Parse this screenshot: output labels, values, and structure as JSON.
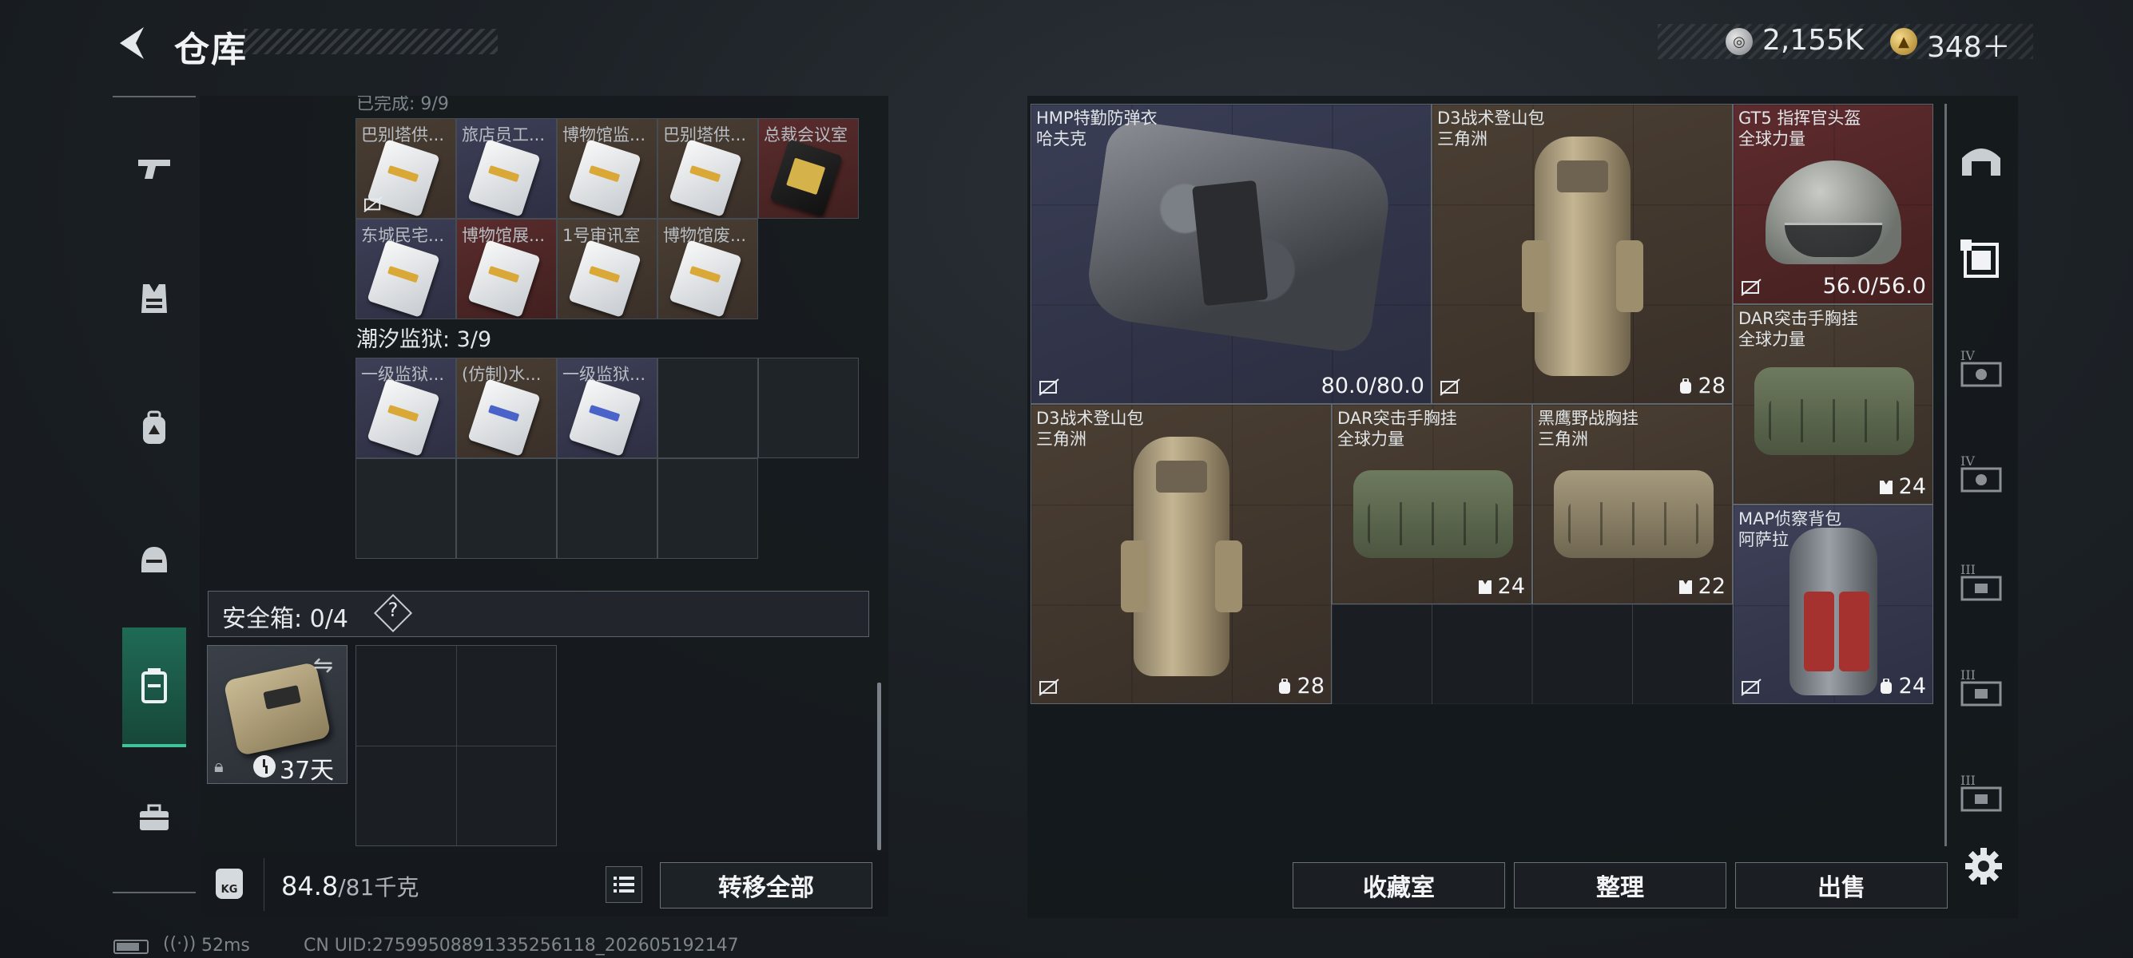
{
  "header": {
    "title": "仓库",
    "currency_1_value": "2,155K",
    "currency_2_value": "348＋"
  },
  "left_nav": {
    "items": [
      "gun-icon",
      "vest-icon",
      "backpack-icon",
      "helmet-icon",
      "container-icon",
      "toolbox-icon"
    ],
    "active": "container-icon"
  },
  "container": {
    "cut_header": "已完成: 9/9",
    "row1": [
      {
        "label": "巴别塔供...",
        "bg": "brown",
        "card": "white"
      },
      {
        "label": "旅店员工...",
        "bg": "purple",
        "card": "white"
      },
      {
        "label": "博物馆监...",
        "bg": "brown",
        "card": "white"
      },
      {
        "label": "巴别塔供...",
        "bg": "brown",
        "card": "white"
      },
      {
        "label": "总裁会议室",
        "bg": "red",
        "card": "gold"
      }
    ],
    "row2": [
      {
        "label": "东城民宅...",
        "bg": "purple",
        "card": "white"
      },
      {
        "label": "博物馆展...",
        "bg": "red",
        "card": "white"
      },
      {
        "label": "1号审讯室",
        "bg": "brown",
        "card": "white"
      },
      {
        "label": "博物馆废...",
        "bg": "brown",
        "card": "white"
      }
    ],
    "section_label": "潮汐监狱: 3/9",
    "section_items": [
      {
        "label": "一级监狱...",
        "bg": "purple",
        "card": "white"
      },
      {
        "label": "(仿制)水...",
        "bg": "brown",
        "card": "blue"
      },
      {
        "label": "一级监狱...",
        "bg": "purple",
        "card": "blue"
      }
    ]
  },
  "safe_box": {
    "label": "安全箱: 0/4",
    "help": "?",
    "item_days": "37天"
  },
  "weight": {
    "kg_label": "KG",
    "current": "84.8",
    "max": "/81千克"
  },
  "buttons": {
    "transfer_all": "转移全部",
    "collection_room": "收藏室",
    "organize": "整理",
    "sell": "出售"
  },
  "status_bar": {
    "ping": "52ms",
    "uid": "CN UID:2759950889133525611​8_202605192147"
  },
  "storage": {
    "items": [
      {
        "id": "vest",
        "name": "HMP特勤防弹衣\n哈夫克",
        "stat": "80.0/80.0",
        "stat_type": "durability"
      },
      {
        "id": "d3_pack_1",
        "name": "D3战术登山包\n三角洲",
        "stat": "28",
        "stat_type": "capacity"
      },
      {
        "id": "gt5_helmet",
        "name": "GT5 指挥官头盔\n全球力量",
        "stat": "56.0/56.0",
        "stat_type": "durability"
      },
      {
        "id": "dar_rig_1",
        "name": "DAR突击手胸挂\n全球力量",
        "stat": "24",
        "stat_type": "rig"
      },
      {
        "id": "d3_pack_2",
        "name": "D3战术登山包\n三角洲",
        "stat": "28",
        "stat_type": "capacity"
      },
      {
        "id": "dar_rig_2",
        "name": "DAR突击手胸挂\n全球力量",
        "stat": "24",
        "stat_type": "rig"
      },
      {
        "id": "blackhawk_rig",
        "name": "黑鹰野战胸挂\n三角洲",
        "stat": "22",
        "stat_type": "rig"
      },
      {
        "id": "map_pack",
        "name": "MAP侦察背包\n阿萨拉",
        "stat": "24",
        "stat_type": "capacity"
      }
    ]
  },
  "right_nav": {
    "items": [
      "safehouse-icon",
      "storage-tab-icon",
      "tier-iv-storage-icon-1",
      "tier-iv-storage-icon-2",
      "tier-iii-storage-icon-1",
      "tier-iii-storage-icon-2",
      "tier-iii-storage-icon-3"
    ],
    "tier_labels": [
      "IV",
      "IV",
      "III",
      "III",
      "III"
    ]
  }
}
